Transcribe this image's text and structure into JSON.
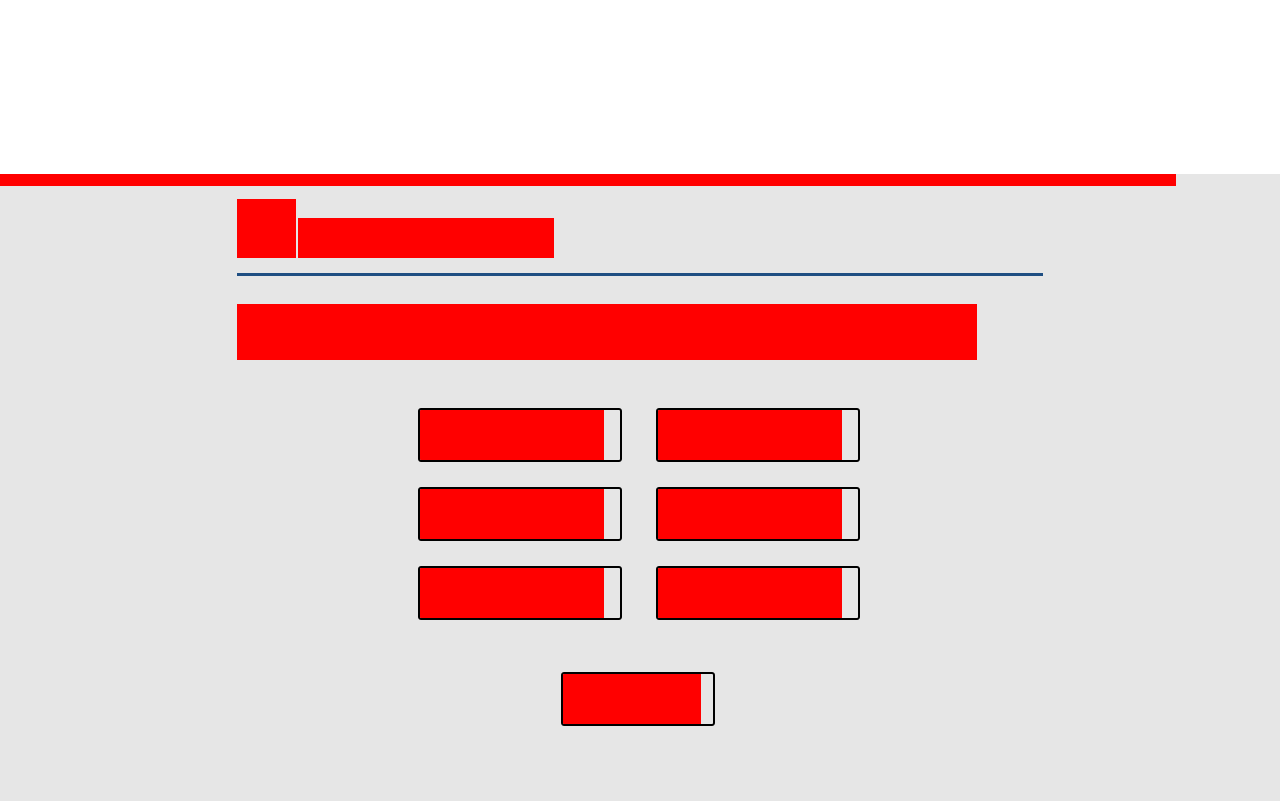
{
  "header": {
    "brand_title": ""
  },
  "banner": {
    "text": ""
  },
  "options": [
    {
      "label": ""
    },
    {
      "label": ""
    },
    {
      "label": ""
    },
    {
      "label": ""
    },
    {
      "label": ""
    },
    {
      "label": ""
    }
  ],
  "submit": {
    "label": ""
  },
  "colors": {
    "accent": "#ff0000",
    "rule": "#1f4e82",
    "background": "#e6e6e6",
    "button_border": "#000000"
  }
}
